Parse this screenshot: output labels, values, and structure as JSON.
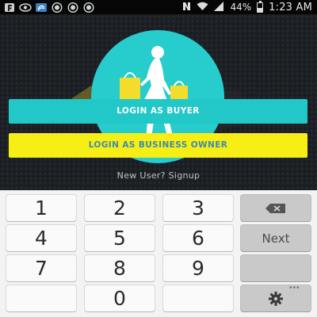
{
  "status_bar": {
    "left_icons": [
      "notification-f-icon",
      "notification-eye-icon",
      "notification-sync-icon",
      "notification-whatsapp-icon",
      "notification-whatsapp-icon",
      "notification-whatsapp-icon"
    ],
    "right_icons": [
      "nfc-icon",
      "wifi-icon",
      "signal-icon",
      "battery-icon"
    ],
    "battery": "44%",
    "battery_level": 0.44,
    "time": "1:23 AM"
  },
  "app": {
    "logo_icon": "shopping-woman-logo",
    "logo_color": "#27cccc",
    "login_buyer_label": "LOGIN AS BUYER",
    "login_owner_label": "LOGIN AS BUSINESS OWNER",
    "signup_label": "New User? Signup",
    "buyer_color": "#22c7c7",
    "owner_color": "#f7ee15"
  },
  "keyboard": {
    "keys": [
      "1",
      "2",
      "3",
      "4",
      "5",
      "6",
      "Next",
      "7",
      "8",
      "9",
      "0"
    ],
    "backspace_icon": "backspace-icon",
    "settings_icon": "gear-icon",
    "more_icon": "more-dots-icon"
  }
}
